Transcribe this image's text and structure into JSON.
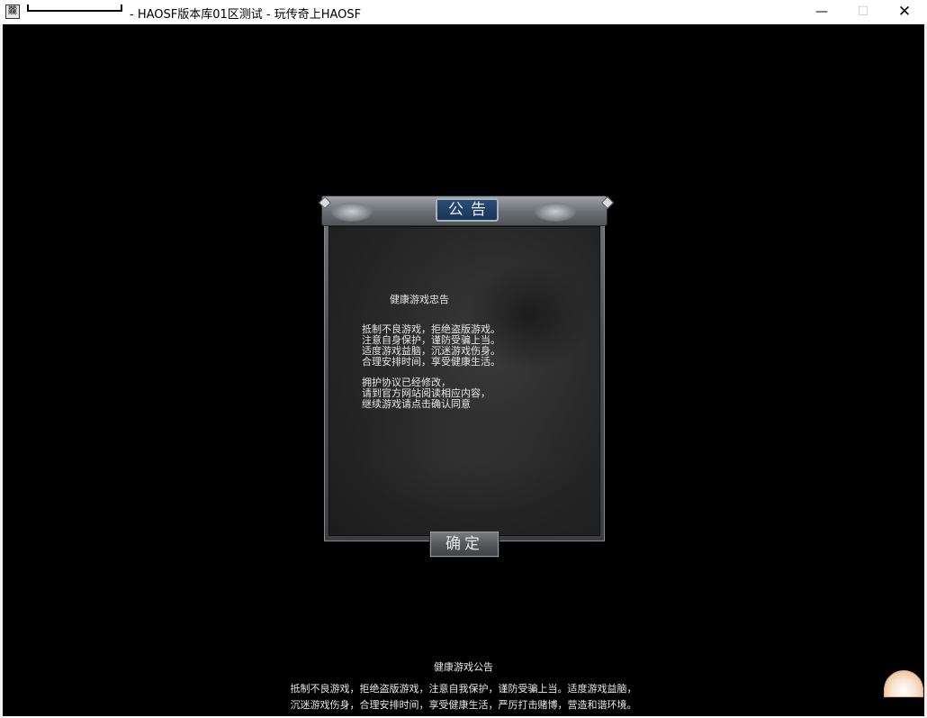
{
  "window": {
    "title": "- HAOSF版本库01区测试 - 玩传奇上HAOSF",
    "icon": "game-app-icon",
    "icon_glyph": "龖",
    "minimize_glyph": "—",
    "maximize_glyph": "☐",
    "close_glyph": "✕"
  },
  "dialog": {
    "title": "公告",
    "heading": "健康游戏忠告",
    "lines": [
      "抵制不良游戏，拒绝盗版游戏。",
      "注意自身保护，谨防受骗上当。",
      "适度游戏益脑，沉迷游戏伤身。",
      "合理安排时间，享受健康生活。"
    ],
    "lines2": [
      "拥护协议已经修改，",
      "请到官方网站阅读相应内容，",
      "继续游戏请点击确认同意"
    ],
    "confirm_label": "确定"
  },
  "footer": {
    "title": "健康游戏公告",
    "line1": "抵制不良游戏，拒绝盗版游戏，注意自我保护，谨防受骗上当。适度游戏益脑，",
    "line2": "沉迷游戏伤身，合理安排时间，享受健康生活，严厉打击赌博，营造和谐环境。"
  }
}
